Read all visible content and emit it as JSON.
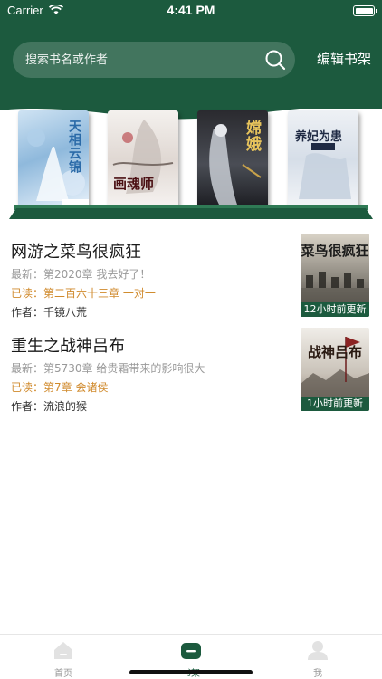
{
  "status_bar": {
    "carrier": "Carrier",
    "time": "4:41 PM"
  },
  "header": {
    "search_placeholder": "搜索书名或作者",
    "edit_label": "编辑书架",
    "bg_color": "#1c5a3e"
  },
  "shelf": {
    "books": [
      {
        "title": "天相云锦"
      },
      {
        "title": "画魂师"
      },
      {
        "title": "嫦娥"
      },
      {
        "title": "养妃为患"
      }
    ]
  },
  "list": [
    {
      "name": "网游之菜鸟很疯狂",
      "latest": "最新：第2020章 我去好了！",
      "read": "已读：第二百六十三章 一对一",
      "author": "作者：千镜八荒",
      "cover_title": "菜鸟很疯狂",
      "badge": "12小时前更新"
    },
    {
      "name": "重生之战神吕布",
      "latest": "最新：第5730章 给贵霜带来的影响很大",
      "read": "已读：第7章 会诸侯",
      "author": "作者：流浪的猴",
      "cover_title": "战神吕布",
      "badge": "1小时前更新"
    }
  ],
  "tabbar": {
    "tabs": [
      {
        "label": "首页",
        "icon": "home-icon"
      },
      {
        "label": "书架",
        "icon": "bookshelf-icon"
      },
      {
        "label": "我",
        "icon": "profile-icon"
      }
    ],
    "active": "书架",
    "accent": "#1c5a3e"
  }
}
